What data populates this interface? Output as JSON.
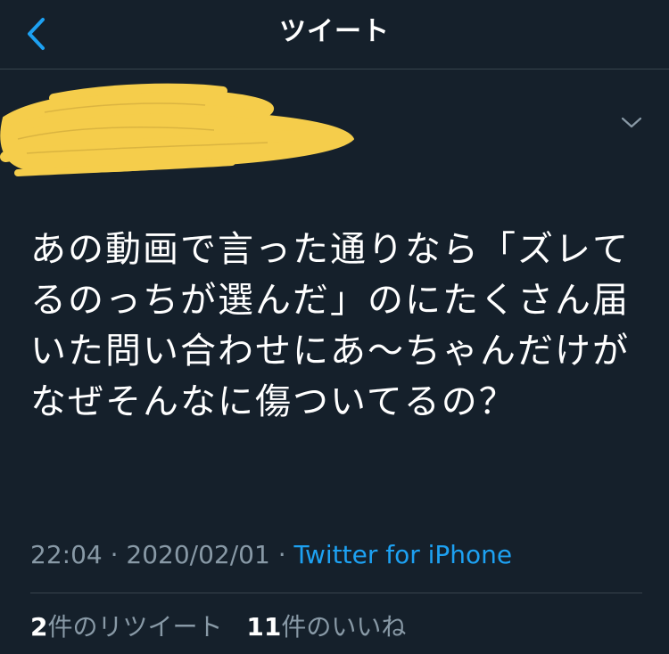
{
  "header": {
    "title": "ツイート"
  },
  "tweet": {
    "text": "あの動画で言った通りなら「ズレてるのっちが選んだ」のにたくさん届いた問い合わせにあ〜ちゃんだけがなぜそんなに傷ついてるの？",
    "time": "22:04",
    "separator": " · ",
    "date": "2020/02/01",
    "source": "Twitter for iPhone"
  },
  "stats": {
    "retweet_count": "2",
    "retweet_label": "件のリツイート",
    "like_count": "11",
    "like_label": "件のいいね"
  },
  "colors": {
    "background": "#15202b",
    "accent": "#1da1f2",
    "secondary_text": "#8899a6",
    "redaction": "#f5cd4b"
  },
  "icons": {
    "back": "chevron-left-icon",
    "more": "chevron-down-icon"
  }
}
